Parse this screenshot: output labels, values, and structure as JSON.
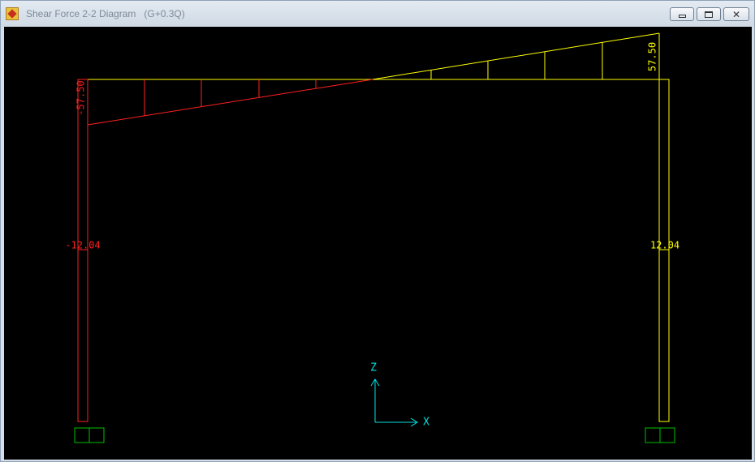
{
  "window": {
    "title": "Shear Force 2-2 Diagram",
    "subtitle": "(G+0.3Q)",
    "icon": "app-icon",
    "buttons": [
      {
        "name": "minimize-button",
        "icon": "minimize-icon"
      },
      {
        "name": "restore-button",
        "icon": "restore-icon"
      },
      {
        "name": "close-button",
        "icon": "close-icon"
      }
    ]
  },
  "diagram": {
    "labels": {
      "left_top": "-57.50",
      "right_top": "57.50",
      "left_column": "-12.04",
      "right_column": "12.04"
    },
    "axes": {
      "z": "Z",
      "x": "X"
    },
    "colors": {
      "frame": "#ffff00",
      "negative": "#ff2020",
      "support": "#00c000",
      "axes": "#00e0e0",
      "background": "#000000"
    }
  }
}
